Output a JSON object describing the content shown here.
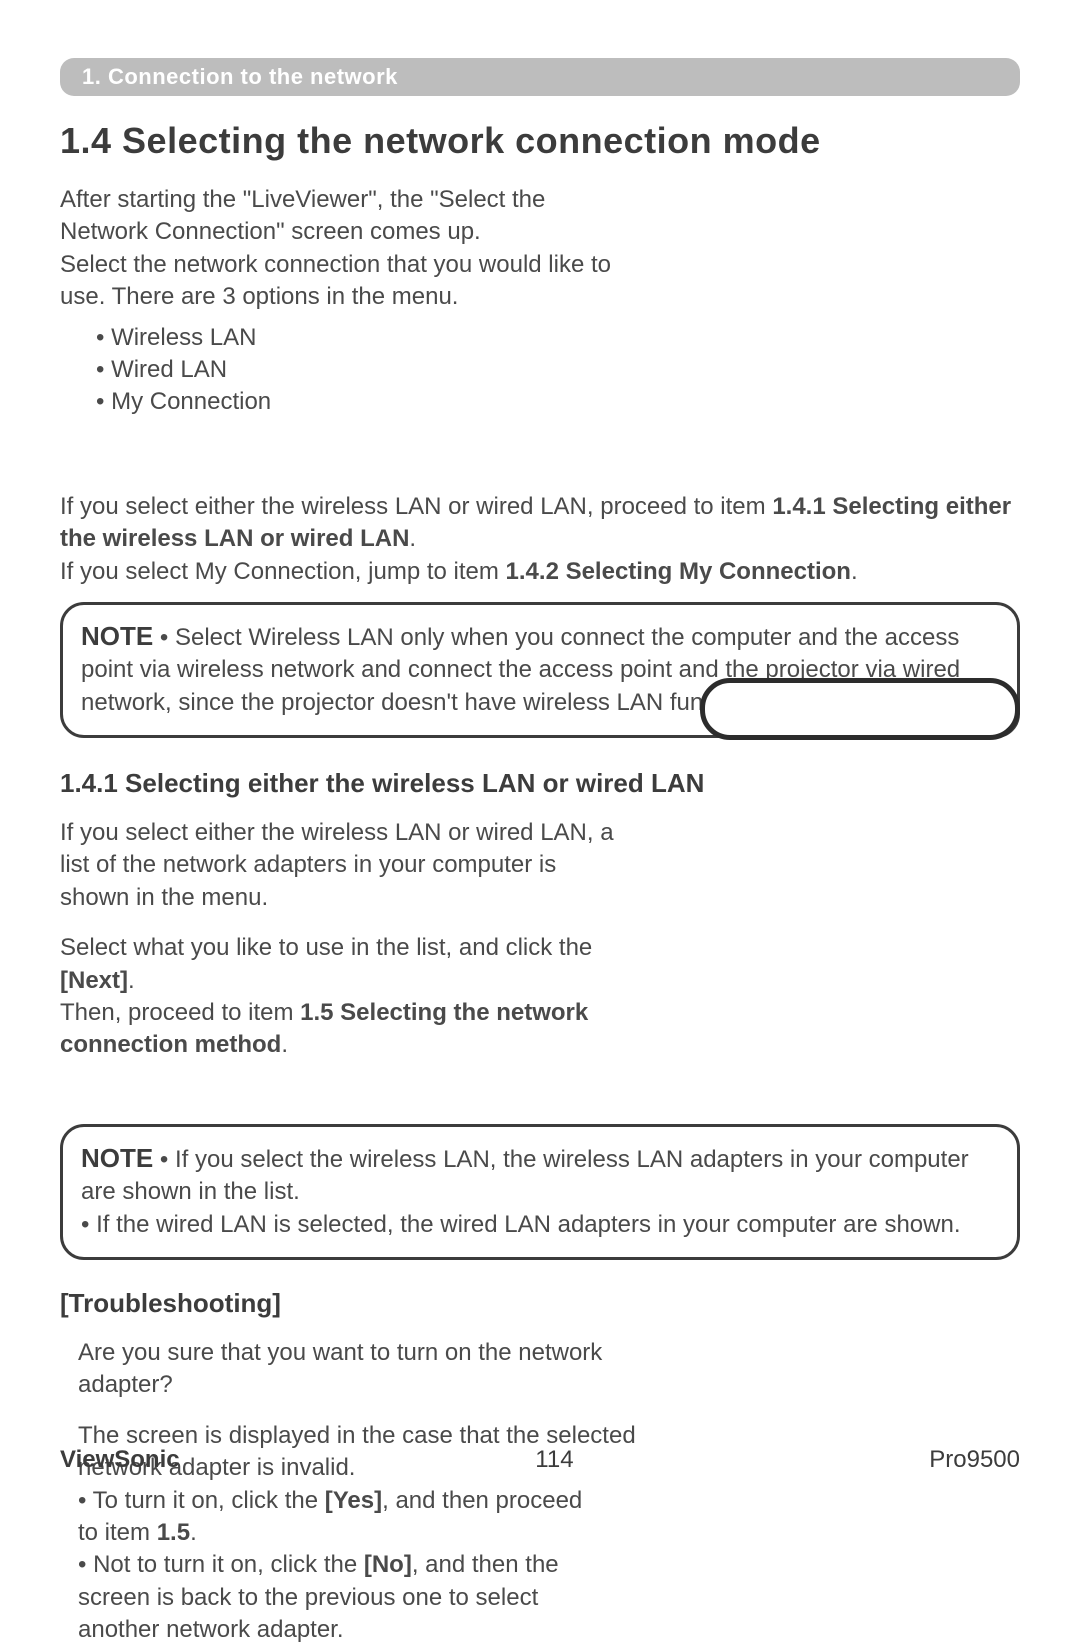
{
  "header": {
    "breadcrumb": "1. Connection to the network"
  },
  "title": "1.4 Selecting the network connection mode",
  "intro": {
    "p1": "After starting the \"LiveViewer\", the \"Select the Network Connection\" screen comes up.",
    "p2": "Select the network connection that you would like to use. There are 3 options in the menu.",
    "opts": {
      "o1": "• Wireless LAN",
      "o2": "• Wired LAN",
      "o3": "• My Connection"
    }
  },
  "para2": {
    "l1a": "If you select either the wireless LAN or wired LAN, proceed to item ",
    "l1b": "1.4.1 Selecting either the wireless LAN or wired LAN",
    "l1c": ".",
    "l2a": "If you select My Connection, jump to item ",
    "l2b": "1.4.2 Selecting My Connection",
    "l2c": "."
  },
  "note1": {
    "label": "NOTE",
    "text": "  • Select Wireless LAN only when you connect the computer and the access point via wireless network and connect the access point and the projector via wired network, since the projector doesn't have wireless LAN function."
  },
  "sub141": {
    "title": "1.4.1 Selecting either the wireless LAN or wired LAN",
    "p1": "If you select either the wireless LAN or wired LAN, a list of the network adapters in your computer is shown in the menu.",
    "p2a": "Select what you like to use in the list, and click the ",
    "p2b": "[Next]",
    "p2c": ".",
    "p3a": "Then, proceed to item ",
    "p3b": "1.5 Selecting the network connection method",
    "p3c": "."
  },
  "note2": {
    "label": "NOTE",
    "b1": "  • If you select the wireless LAN, the wireless LAN adapters in your computer are shown in the list.",
    "b2": "• If the wired LAN is selected, the wired LAN adapters in your computer are shown."
  },
  "trouble": {
    "title": "[Troubleshooting]",
    "q": "Are you sure that you want to turn on the network adapter?",
    "p1": "The screen is displayed in the case that the selected network adapter is invalid.",
    "b1a": "• To turn it on, click the ",
    "b1b": "[Yes]",
    "b1c": ", and then proceed",
    "b1d": " to item ",
    "b1e": "1.5",
    "b1f": ".",
    "b2a": "• Not to turn it on, click the ",
    "b2b": "[No]",
    "b2c": ", and then the",
    "b2d": " screen is back to the previous one to select",
    "b2e": " another network adapter."
  },
  "footer": {
    "brand": "ViewSonic",
    "page": "114",
    "model": "Pro9500"
  }
}
